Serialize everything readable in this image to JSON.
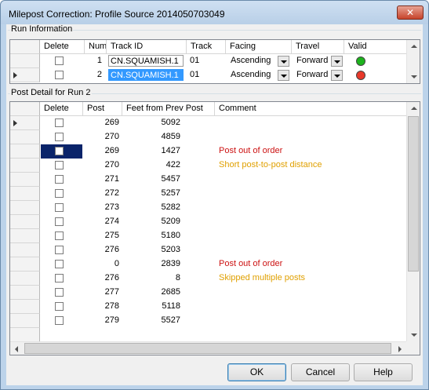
{
  "window": {
    "title": "Milepost Correction: Profile Source 2014050703049",
    "close_glyph": "✕"
  },
  "run_info": {
    "group_label": "Run Information",
    "columns": [
      "Delete",
      "Num",
      "Track ID",
      "Track",
      "Facing",
      "Travel",
      "Valid"
    ],
    "rows": [
      {
        "num": "1",
        "track_id": "CN.SQUAMISH.1",
        "track": "01",
        "facing": "Ascending",
        "travel": "Forward",
        "valid_color": "#1db31d",
        "current": false,
        "selected_track": false
      },
      {
        "num": "2",
        "track_id": "CN.SQUAMISH.1",
        "track": "01",
        "facing": "Ascending",
        "travel": "Forward",
        "valid_color": "#e8382a",
        "current": true,
        "selected_track": true
      }
    ]
  },
  "post_detail": {
    "group_label": "Post Detail for Run 2",
    "columns": [
      "Delete",
      "Post",
      "Feet from Prev Post",
      "Comment"
    ],
    "rows": [
      {
        "post": "269",
        "feet": "5092",
        "comment": "",
        "comment_color": ""
      },
      {
        "post": "270",
        "feet": "4859",
        "comment": "",
        "comment_color": ""
      },
      {
        "post": "269",
        "feet": "1427",
        "comment": "Post out of order",
        "comment_color": "#cc1111"
      },
      {
        "post": "270",
        "feet": "422",
        "comment": "Short post-to-post distance",
        "comment_color": "#e0a000"
      },
      {
        "post": "271",
        "feet": "5457",
        "comment": "",
        "comment_color": ""
      },
      {
        "post": "272",
        "feet": "5257",
        "comment": "",
        "comment_color": ""
      },
      {
        "post": "273",
        "feet": "5282",
        "comment": "",
        "comment_color": ""
      },
      {
        "post": "274",
        "feet": "5209",
        "comment": "",
        "comment_color": ""
      },
      {
        "post": "275",
        "feet": "5180",
        "comment": "",
        "comment_color": ""
      },
      {
        "post": "276",
        "feet": "5203",
        "comment": "",
        "comment_color": ""
      },
      {
        "post": "0",
        "feet": "2839",
        "comment": "Post out of order",
        "comment_color": "#cc1111"
      },
      {
        "post": "276",
        "feet": "8",
        "comment": "Skipped multiple posts",
        "comment_color": "#e0a000"
      },
      {
        "post": "277",
        "feet": "2685",
        "comment": "",
        "comment_color": ""
      },
      {
        "post": "278",
        "feet": "5118",
        "comment": "",
        "comment_color": ""
      },
      {
        "post": "279",
        "feet": "5527",
        "comment": "",
        "comment_color": ""
      }
    ]
  },
  "buttons": {
    "ok": "OK",
    "cancel": "Cancel",
    "help": "Help"
  }
}
